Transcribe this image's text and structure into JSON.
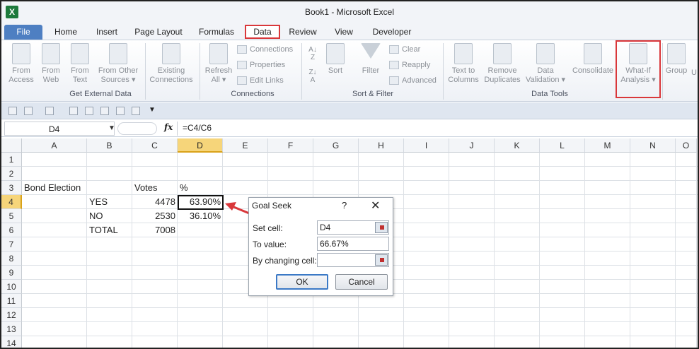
{
  "window": {
    "title": "Book1  -  Microsoft Excel",
    "app_icon": "X"
  },
  "tabs": [
    {
      "label": "File"
    },
    {
      "label": "Home"
    },
    {
      "label": "Insert"
    },
    {
      "label": "Page Layout"
    },
    {
      "label": "Formulas"
    },
    {
      "label": "Data"
    },
    {
      "label": "Review"
    },
    {
      "label": "View"
    },
    {
      "label": "Developer"
    }
  ],
  "ribbon": {
    "from_access": "From\nAccess",
    "from_web": "From\nWeb",
    "from_text": "From\nText",
    "from_other": "From Other\nSources ▾",
    "existing": "Existing\nConnections",
    "refresh": "Refresh\nAll ▾",
    "connections": "Connections",
    "properties": "Properties",
    "edit_links": "Edit Links",
    "sort": "Sort",
    "filter": "Filter",
    "clear": "Clear",
    "reapply": "Reapply",
    "advanced": "Advanced",
    "text_to_columns": "Text to\nColumns",
    "remove_duplicates": "Remove\nDuplicates",
    "data_validation": "Data\nValidation ▾",
    "consolidate": "Consolidate",
    "what_if": "What-If\nAnalysis ▾",
    "group": "Group",
    "ungroup": "U",
    "group_labels": {
      "get_external": "Get External Data",
      "connections": "Connections",
      "sort_filter": "Sort & Filter",
      "data_tools": "Data Tools"
    }
  },
  "formula_bar": {
    "name_box": "D4",
    "fx": "fx",
    "formula": "=C4/C6"
  },
  "sheet": {
    "columns": [
      "A",
      "B",
      "C",
      "D",
      "E",
      "F",
      "G",
      "H",
      "I",
      "J",
      "K",
      "L",
      "M",
      "N",
      "O"
    ],
    "rows": [
      "1",
      "2",
      "3",
      "4",
      "5",
      "6",
      "7",
      "8",
      "9",
      "10",
      "11",
      "12",
      "13",
      "14"
    ],
    "cells": {
      "A3": "Bond Election",
      "C3": "Votes",
      "D3": "%",
      "B4": "YES",
      "C4": "4478",
      "D4": "63.90%",
      "B5": "NO",
      "C5": "2530",
      "D5": "36.10%",
      "B6": "TOTAL",
      "C6": "7008"
    }
  },
  "goal_seek": {
    "title": "Goal Seek",
    "help": "?",
    "close": "✕",
    "set_cell_label": "Set cell:",
    "set_cell_value": "D4",
    "to_value_label": "To value:",
    "to_value_value": "66.67%",
    "by_changing_label": "By changing cell:",
    "by_changing_value": "",
    "ok_label": "OK",
    "cancel_label": "Cancel"
  },
  "colors": {
    "highlight_red": "#d9373a",
    "selected_header": "#f6d57a",
    "file_tab": "#4e7fc2"
  }
}
